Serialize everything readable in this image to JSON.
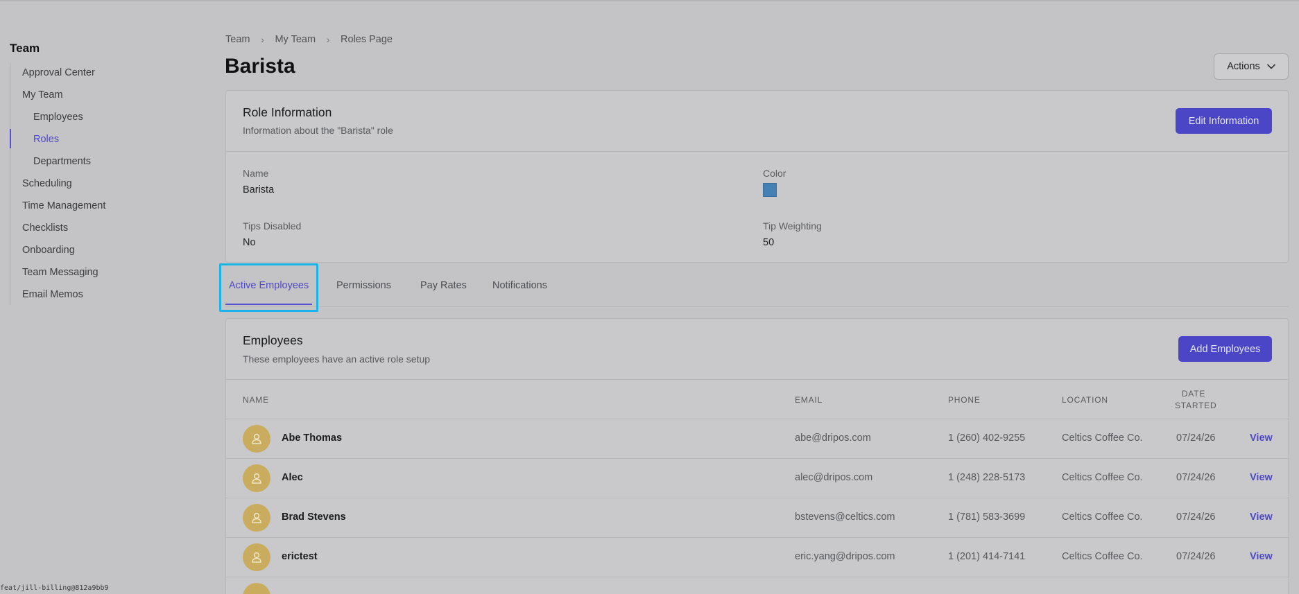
{
  "sidebar": {
    "title": "Team",
    "items": [
      {
        "label": "Approval Center"
      },
      {
        "label": "My Team"
      },
      {
        "label": "Employees"
      },
      {
        "label": "Roles"
      },
      {
        "label": "Departments"
      },
      {
        "label": "Scheduling"
      },
      {
        "label": "Time Management"
      },
      {
        "label": "Checklists"
      },
      {
        "label": "Onboarding"
      },
      {
        "label": "Team Messaging"
      },
      {
        "label": "Email Memos"
      }
    ],
    "active_item": "Roles"
  },
  "footer": {
    "git_ref": "feat/jill-billing@812a9bb9"
  },
  "breadcrumb": [
    "Team",
    "My Team",
    "Roles Page"
  ],
  "page_title": "Barista",
  "actions": {
    "label": "Actions"
  },
  "role_info": {
    "title": "Role Information",
    "subtitle": "Information about the \"Barista\" role",
    "edit_label": "Edit Information",
    "fields": {
      "name_label": "Name",
      "name_value": "Barista",
      "color_label": "Color",
      "color_value": "#4580b4",
      "tips_label": "Tips Disabled",
      "tips_value": "No",
      "weight_label": "Tip Weighting",
      "weight_value": "50"
    }
  },
  "tabs": [
    {
      "label": "Active Employees",
      "active": true
    },
    {
      "label": "Permissions"
    },
    {
      "label": "Pay Rates"
    },
    {
      "label": "Notifications"
    }
  ],
  "employees": {
    "title": "Employees",
    "subtitle": "These employees have an active role setup",
    "add_label": "Add Employees",
    "columns": {
      "name": "Name",
      "email": "Email",
      "phone": "Phone",
      "location": "Location",
      "date_line1": "Date",
      "date_line2": "Started"
    },
    "rows": [
      {
        "name": "Abe Thomas",
        "email": "abe@dripos.com",
        "phone": "1 (260) 402-9255",
        "location": "Celtics Coffee Co.",
        "date": "07/24/26",
        "action": "View"
      },
      {
        "name": "Alec",
        "email": "alec@dripos.com",
        "phone": "1 (248) 228-5173",
        "location": "Celtics Coffee Co.",
        "date": "07/24/26",
        "action": "View"
      },
      {
        "name": "Brad Stevens",
        "email": "bstevens@celtics.com",
        "phone": "1 (781) 583-3699",
        "location": "Celtics Coffee Co.",
        "date": "07/24/26",
        "action": "View"
      },
      {
        "name": "erictest",
        "email": "eric.yang@dripos.com",
        "phone": "1 (201) 414-7141",
        "location": "Celtics Coffee Co.",
        "date": "07/24/26",
        "action": "View"
      }
    ]
  },
  "colors": {
    "accent": "#4b46c6",
    "avatar": "#c9ac5e",
    "focus_ring": "#1ab4e8"
  }
}
